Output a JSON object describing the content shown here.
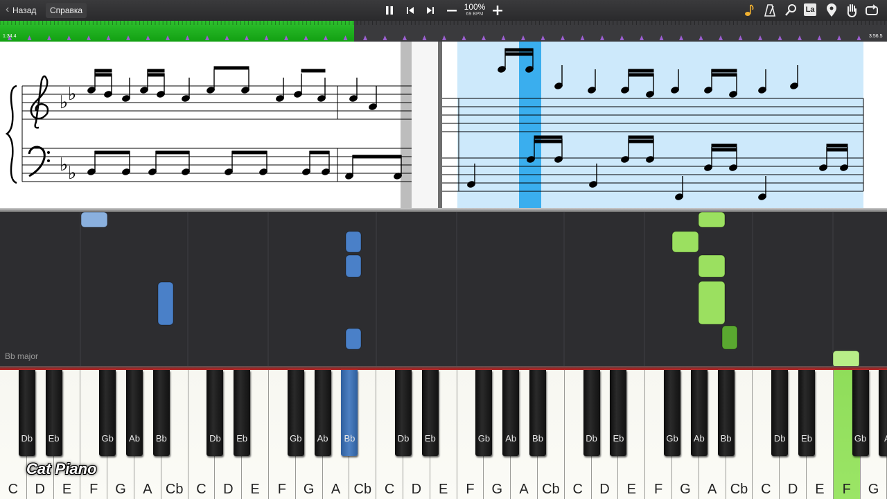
{
  "toolbar": {
    "back_label": "Назад",
    "help_label": "Справка",
    "pause_icon": "pause-icon",
    "prev_icon": "skip-back-icon",
    "next_icon": "skip-forward-icon",
    "zoom_out_icon": "minus-icon",
    "zoom_in_icon": "plus-icon",
    "tempo_percent": "100%",
    "tempo_bpm": "69 BPM",
    "right_icons": [
      "note-icon",
      "metronome-icon",
      "magnifier-icon",
      "note-names-icon",
      "location-pin-icon",
      "hand-icon",
      "loop-icon"
    ],
    "note_names_label": "La"
  },
  "timeline": {
    "current_time": "1:34.4",
    "total_time": "3:56.5",
    "progress": 0.4,
    "played_color": "#1fae1f"
  },
  "roll": {
    "key_signature": "Bb major",
    "left_hand_color": "#4a80c8",
    "right_hand_color": "#9be060"
  },
  "keyboard": {
    "white_keys": [
      "C",
      "D",
      "E",
      "F",
      "G",
      "A",
      "Cb",
      "C",
      "D",
      "E",
      "F",
      "G",
      "A",
      "Cb",
      "C",
      "D",
      "E",
      "F",
      "G",
      "A",
      "Cb",
      "C",
      "D",
      "E",
      "F",
      "G",
      "A",
      "Cb",
      "C",
      "D",
      "E",
      "F",
      "G"
    ],
    "black_keys": [
      "Db",
      "Eb",
      "Gb",
      "Ab",
      "Bb",
      "Db",
      "Eb",
      "Gb",
      "Ab",
      "Bb",
      "Db",
      "Eb",
      "Gb",
      "Ab",
      "Bb",
      "Db",
      "Eb",
      "Gb",
      "Ab",
      "Bb",
      "Db",
      "Eb",
      "Gb",
      "A"
    ],
    "lit_white_index": 31,
    "lit_black_index": 9
  },
  "branding": {
    "logo": "Cat Piano"
  }
}
